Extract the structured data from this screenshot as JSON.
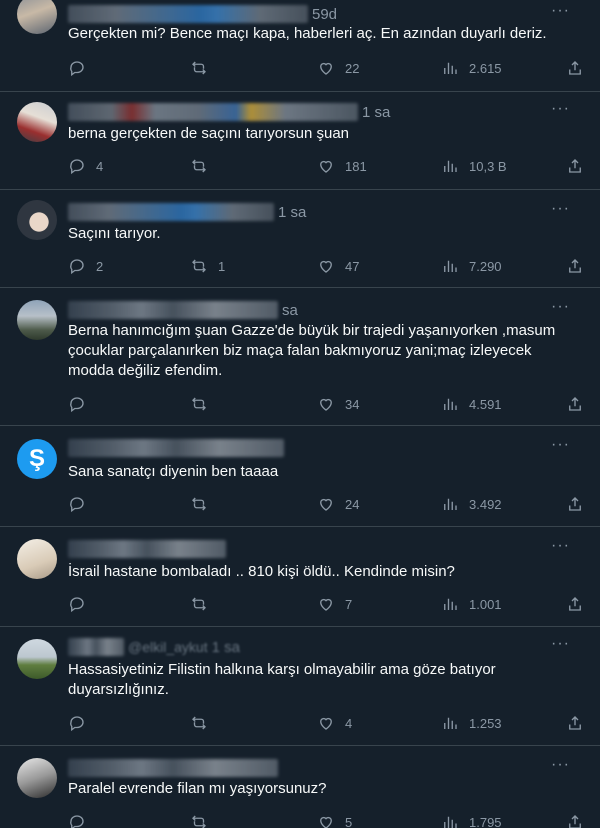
{
  "tweets": [
    {
      "time": "59d",
      "text": "Gerçekten mi? Bence maçı kapa, haberleri aç. En azından duyarlı deriz.",
      "replies": "",
      "retweets": "",
      "likes": "22",
      "views": "2.615"
    },
    {
      "time": "1 sa",
      "text": "berna gerçekten de saçını tarıyorsun şuan",
      "replies": "4",
      "retweets": "",
      "likes": "181",
      "views": "10,3 B"
    },
    {
      "time": "1 sa",
      "text": "Saçını tarıyor.",
      "replies": "2",
      "retweets": "1",
      "likes": "47",
      "views": "7.290"
    },
    {
      "time": "sa",
      "text": "Berna hanımcığım şuan Gazze'de büyük bir trajedi yaşanıyorken ,masum çocuklar parçalanırken biz maça falan bakmıyoruz yani;maç izleyecek modda değiliz efendim.",
      "replies": "",
      "retweets": "",
      "likes": "34",
      "views": "4.591"
    },
    {
      "time": "",
      "text": "Sana sanatçı diyenin ben taaaa",
      "replies": "",
      "retweets": "",
      "likes": "24",
      "views": "3.492",
      "logo": "Ş"
    },
    {
      "time": "",
      "text": "İsrail hastane bombaladı .. 810 kişi öldü.. Kendinde misin?",
      "replies": "",
      "retweets": "",
      "likes": "7",
      "views": "1.001"
    },
    {
      "time": "1 sa",
      "handle": "@elkil_aykut",
      "text": "Hassasiyetiniz Filistin halkına karşı olmayabilir ama göze batıyor duyarsızlığınız.",
      "replies": "",
      "retweets": "",
      "likes": "4",
      "views": "1.253"
    },
    {
      "time": "",
      "text": "Paralel evrende filan mı yaşıyorsunuz?",
      "replies": "",
      "retweets": "",
      "likes": "5",
      "views": "1.795"
    }
  ],
  "icons": {
    "reply": "reply-icon",
    "retweet": "retweet-icon",
    "like": "heart-icon",
    "views": "views-icon",
    "share": "share-icon",
    "more": "more-icon"
  },
  "colors": {
    "background": "#15202b",
    "border": "#38444d",
    "muted": "#8b98a5",
    "text": "#f7f9f9",
    "accent": "#1d9bf0"
  }
}
